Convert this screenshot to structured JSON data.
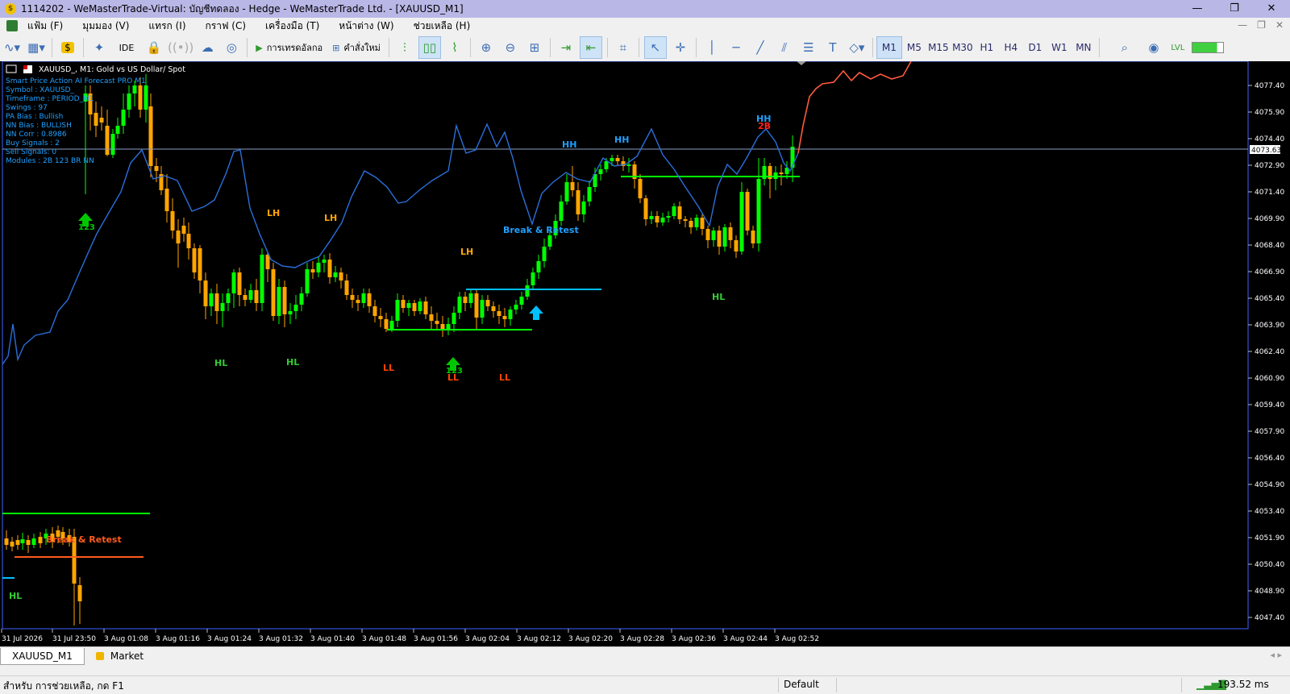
{
  "window": {
    "title": "1114202 - WeMasterTrade-Virtual: บัญชีทดลอง - Hedge - WeMasterTrade Ltd. - [XAUUSD_M1]",
    "minimize": "—",
    "restore": "❐",
    "close": "✕"
  },
  "menu": {
    "items": [
      "แฟ้ม (F)",
      "มุมมอง (V)",
      "แทรก (I)",
      "กราฟ (C)",
      "เครื่องมือ (T)",
      "หน้าต่าง (W)",
      "ช่วยเหลือ (H)"
    ]
  },
  "toolbar": {
    "ide_label": "IDE",
    "algo_label": "การเทรดอัลกอ",
    "new_order_label": "คำสั่งใหม่",
    "timeframes": [
      "M1",
      "M5",
      "M15",
      "M30",
      "H1",
      "H4",
      "D1",
      "W1",
      "MN"
    ],
    "active_timeframe": "M1"
  },
  "chart": {
    "header": "XAUUSD_, M1:  Gold vs US Dollar/ Spot",
    "current_price": "4073.63",
    "info_panel": [
      "Smart Price Action AI Forecast PRO M1",
      "Symbol      : XAUUSD_",
      "Timeframe   : PERIOD_M1",
      "Swings      : 97",
      "PA Bias     : Bullish",
      "NN Bias     : BULLISH",
      "NN Corr     : 0.8986",
      "Buy Signals : 2",
      "Sell Signals: 0",
      "Modules     : 2B 123 BR NN"
    ],
    "price_axis": [
      "4077.40",
      "4075.90",
      "4074.40",
      "4072.90",
      "4071.40",
      "4069.90",
      "4068.40",
      "4066.90",
      "4065.40",
      "4063.90",
      "4062.40",
      "4060.90",
      "4059.40",
      "4057.90",
      "4056.40",
      "4054.90",
      "4053.40",
      "4051.90",
      "4050.40",
      "4048.90",
      "4047.40"
    ],
    "time_axis": [
      "31 Jul 2026",
      "31 Jul 23:50",
      "3 Aug 01:08",
      "3 Aug 01:16",
      "3 Aug 01:24",
      "3 Aug 01:32",
      "3 Aug 01:40",
      "3 Aug 01:48",
      "3 Aug 01:56",
      "3 Aug 02:04",
      "3 Aug 02:12",
      "3 Aug 02:20",
      "3 Aug 02:28",
      "3 Aug 02:36",
      "3 Aug 02:44",
      "3 Aug 02:52"
    ],
    "labels": {
      "lh1": "LH",
      "lh2": "LH",
      "lh3": "LH",
      "hh1": "HH",
      "hh2": "HH",
      "hh3": "HH",
      "hl1": "HL",
      "hl2": "HL",
      "hl3": "HL",
      "hl4": "HL",
      "ll1": "LL",
      "ll2": "LL",
      "ll3": "LL",
      "br1": "Break & Retest",
      "br2": "Break & Retest",
      "tb": "2B",
      "s123a": "123",
      "s123b": "123"
    },
    "colors": {
      "bull": "#00ff00",
      "bear": "#ffa500",
      "forecast_blue": "#2a6fdb",
      "forecast_red": "#ff5a3c",
      "level_green": "#00ff00",
      "level_cyan": "#00bfff",
      "level_orange": "#ff5a1e",
      "lh": "#ffa500",
      "hh": "#1ea0ff",
      "hl": "#32cd32",
      "ll": "#ff4500"
    }
  },
  "tabs": {
    "symbol_tab": "XAUUSD_M1",
    "market_tab": "Market"
  },
  "status": {
    "help": "สำหรับ การช่วยเหลือ, กด F1",
    "profile": "Default",
    "ping": "193.52 ms"
  }
}
